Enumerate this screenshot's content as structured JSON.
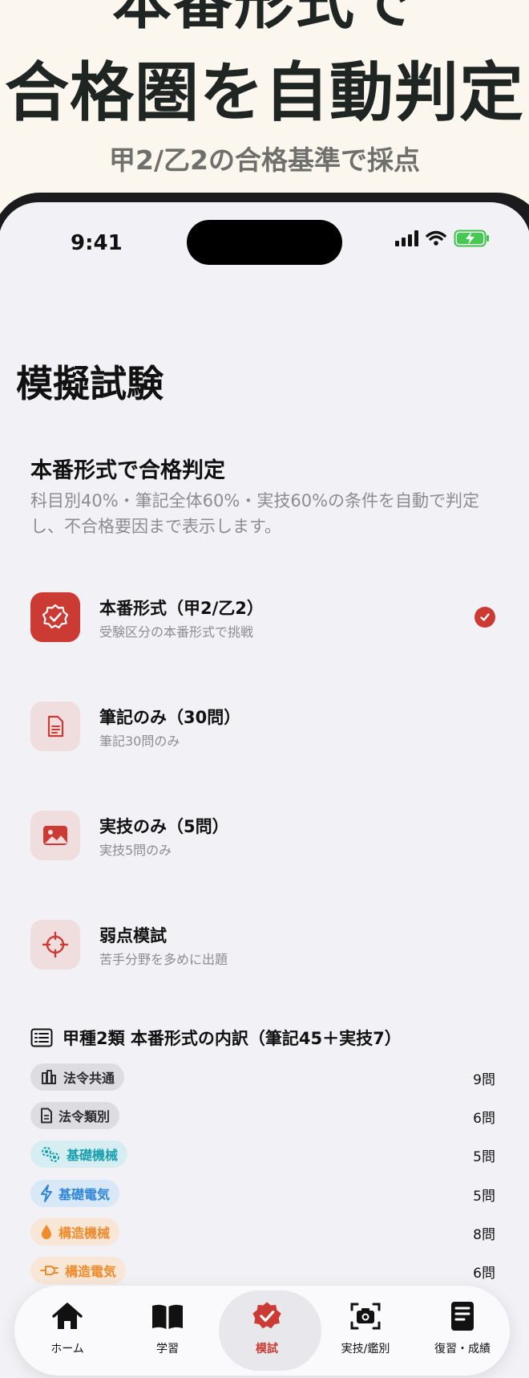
{
  "promo": {
    "headline_1": "本番形式で",
    "headline_2": "合格圏を自動判定",
    "subheadline": "甲2/乙2の合格基準で採点"
  },
  "status_bar": {
    "time": "9:41"
  },
  "page": {
    "title": "模擬試験"
  },
  "intro": {
    "title": "本番形式で合格判定",
    "description": "科目別40%・筆記全体60%・実技60%の条件を自動で判定し、不合格要因まで表示します。"
  },
  "modes": [
    {
      "icon": "badge-check-icon",
      "title": "本番形式（甲2/乙2）",
      "subtitle": "受験区分の本番形式で挑戦",
      "selected": true
    },
    {
      "icon": "document-icon",
      "title": "筆記のみ（30問）",
      "subtitle": "筆記30問のみ",
      "selected": false
    },
    {
      "icon": "image-icon",
      "title": "実技のみ（5問）",
      "subtitle": "実技5問のみ",
      "selected": false
    },
    {
      "icon": "crosshair-icon",
      "title": "弱点模試",
      "subtitle": "苦手分野を多めに出題",
      "selected": false
    }
  ],
  "breakdown": {
    "title": "甲種2類 本番形式の内訳（筆記45＋実技7）",
    "rows": [
      {
        "icon": "building-icon",
        "label": "法令共通",
        "count": "9問",
        "color": "#2c2c30",
        "bg": "#dcdce1"
      },
      {
        "icon": "document-icon",
        "label": "法令類別",
        "count": "6問",
        "color": "#2c2c30",
        "bg": "#dcdce1"
      },
      {
        "icon": "gears-icon",
        "label": "基礎機械",
        "count": "5問",
        "color": "#1a9fae",
        "bg": "#d6eef1"
      },
      {
        "icon": "bolt-icon",
        "label": "基礎電気",
        "count": "5問",
        "color": "#2f86d8",
        "bg": "#d9e8f7"
      },
      {
        "icon": "drop-icon",
        "label": "構造機械",
        "count": "8問",
        "color": "#ee8b2c",
        "bg": "#f8e6d6"
      },
      {
        "icon": "plug-icon",
        "label": "構造電気",
        "count": "6問",
        "color": "#ee8b2c",
        "bg": "#f8e6d6"
      }
    ]
  },
  "colors": {
    "accent": "#cc3a34",
    "background": "#f2f2f6",
    "promo_bg": "#fbf6ee"
  },
  "tabbar": {
    "tabs": [
      {
        "icon": "home-icon",
        "label": "ホーム",
        "active": false
      },
      {
        "icon": "book-icon",
        "label": "学習",
        "active": false
      },
      {
        "icon": "badge-check-icon",
        "label": "模試",
        "active": true
      },
      {
        "icon": "camera-scan-icon",
        "label": "実技/鑑別",
        "active": false
      },
      {
        "icon": "notes-icon",
        "label": "復習・成績",
        "active": false
      }
    ]
  }
}
